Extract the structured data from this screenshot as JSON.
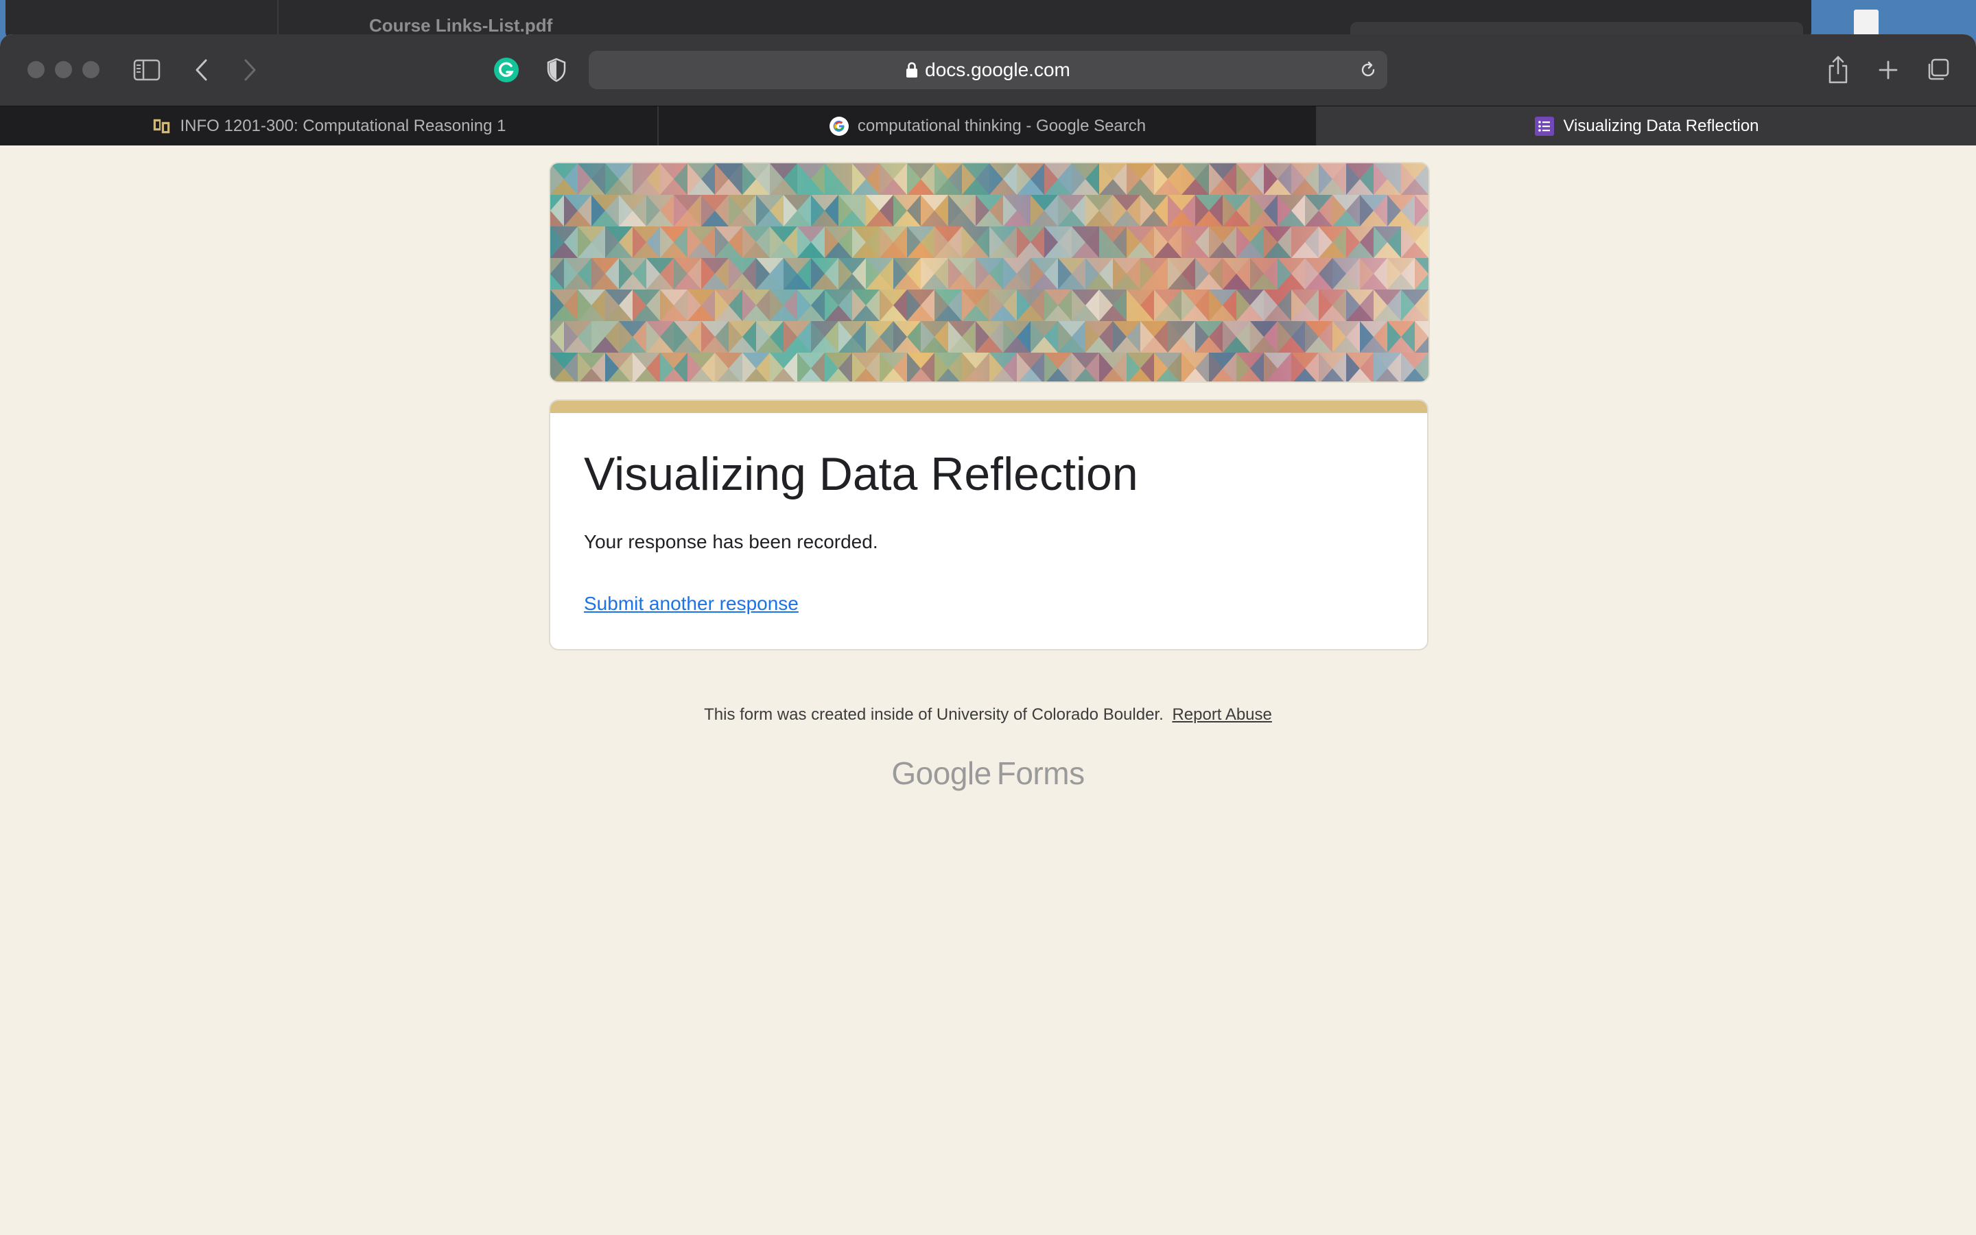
{
  "background_window": {
    "title": "Course Links-List.pdf"
  },
  "browser": {
    "address": "docs.google.com",
    "icons": {
      "close": "traffic-light-close",
      "minimize": "traffic-light-minimize",
      "maximize": "traffic-light-maximize",
      "sidebar": "sidebar-icon",
      "back": "chevron-left-icon",
      "forward": "chevron-right-icon",
      "extension_1": "grammarly-icon",
      "extension_2": "shield-icon",
      "lock": "lock-icon",
      "reload": "reload-icon",
      "share": "share-icon",
      "new_tab": "plus-icon",
      "tab_overview": "tab-overview-icon"
    },
    "tabs": [
      {
        "label": "INFO 1201-300: Computational Reasoning 1",
        "icon": "cu-boulder-icon",
        "active": false
      },
      {
        "label": "computational thinking - Google Search",
        "icon": "google-icon",
        "active": false
      },
      {
        "label": "Visualizing Data Reflection",
        "icon": "google-forms-icon",
        "active": true
      }
    ]
  },
  "form": {
    "title": "Visualizing Data Reflection",
    "confirmation": "Your response has been recorded.",
    "another_link": "Submit another response",
    "accent_color": "#d9bf82"
  },
  "footer": {
    "note": "This form was created inside of University of Colorado Boulder.",
    "report_link": "Report Abuse",
    "brand_google": "Google",
    "brand_forms": "Forms"
  },
  "colors": {
    "page_background": "#f5f0e5",
    "link": "#1a73e8",
    "toolbar": "#38383a"
  }
}
